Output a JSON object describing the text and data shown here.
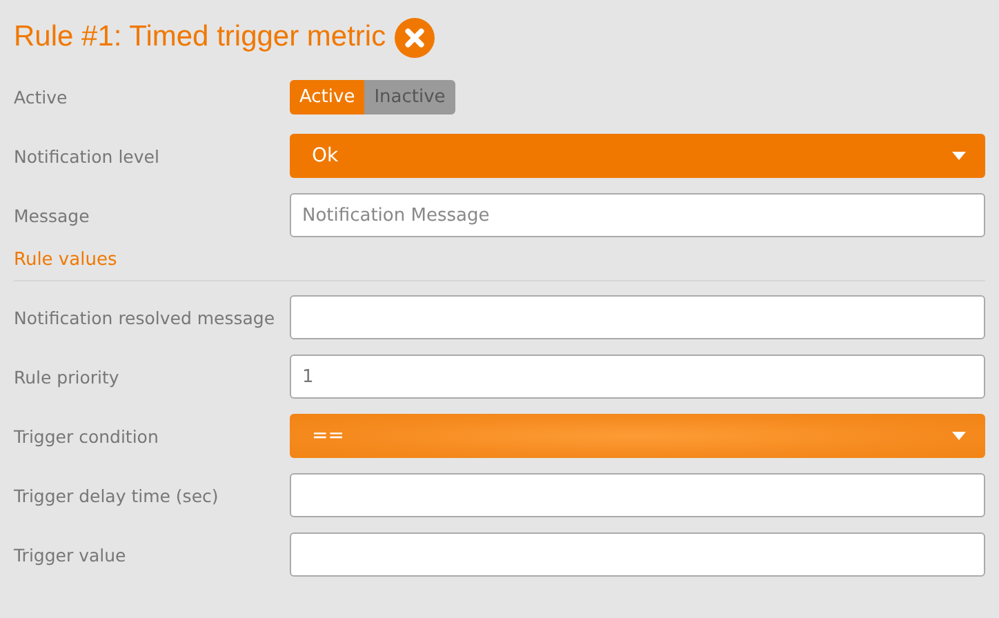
{
  "title": "Rule #1: Timed trigger metric",
  "fields": [
    {
      "kind": "toggle",
      "label": "Active",
      "options": [
        {
          "label": "Active",
          "selected": true
        },
        {
          "label": "Inactive",
          "selected": false
        }
      ]
    },
    {
      "kind": "select",
      "label": "Notification level",
      "value": "Ok",
      "focused": false
    },
    {
      "kind": "text",
      "label": "Message",
      "placeholder": "Notification Message"
    }
  ],
  "section": {
    "title": "Rule values",
    "fields": [
      {
        "kind": "text",
        "label": "Notification resolved message"
      },
      {
        "kind": "text",
        "label": "Rule priority",
        "value": "1"
      },
      {
        "kind": "select",
        "label": "Trigger condition",
        "value": "==",
        "focused": true
      },
      {
        "kind": "text",
        "label": "Trigger delay time (sec)"
      },
      {
        "kind": "text",
        "label": "Trigger value"
      }
    ]
  }
}
